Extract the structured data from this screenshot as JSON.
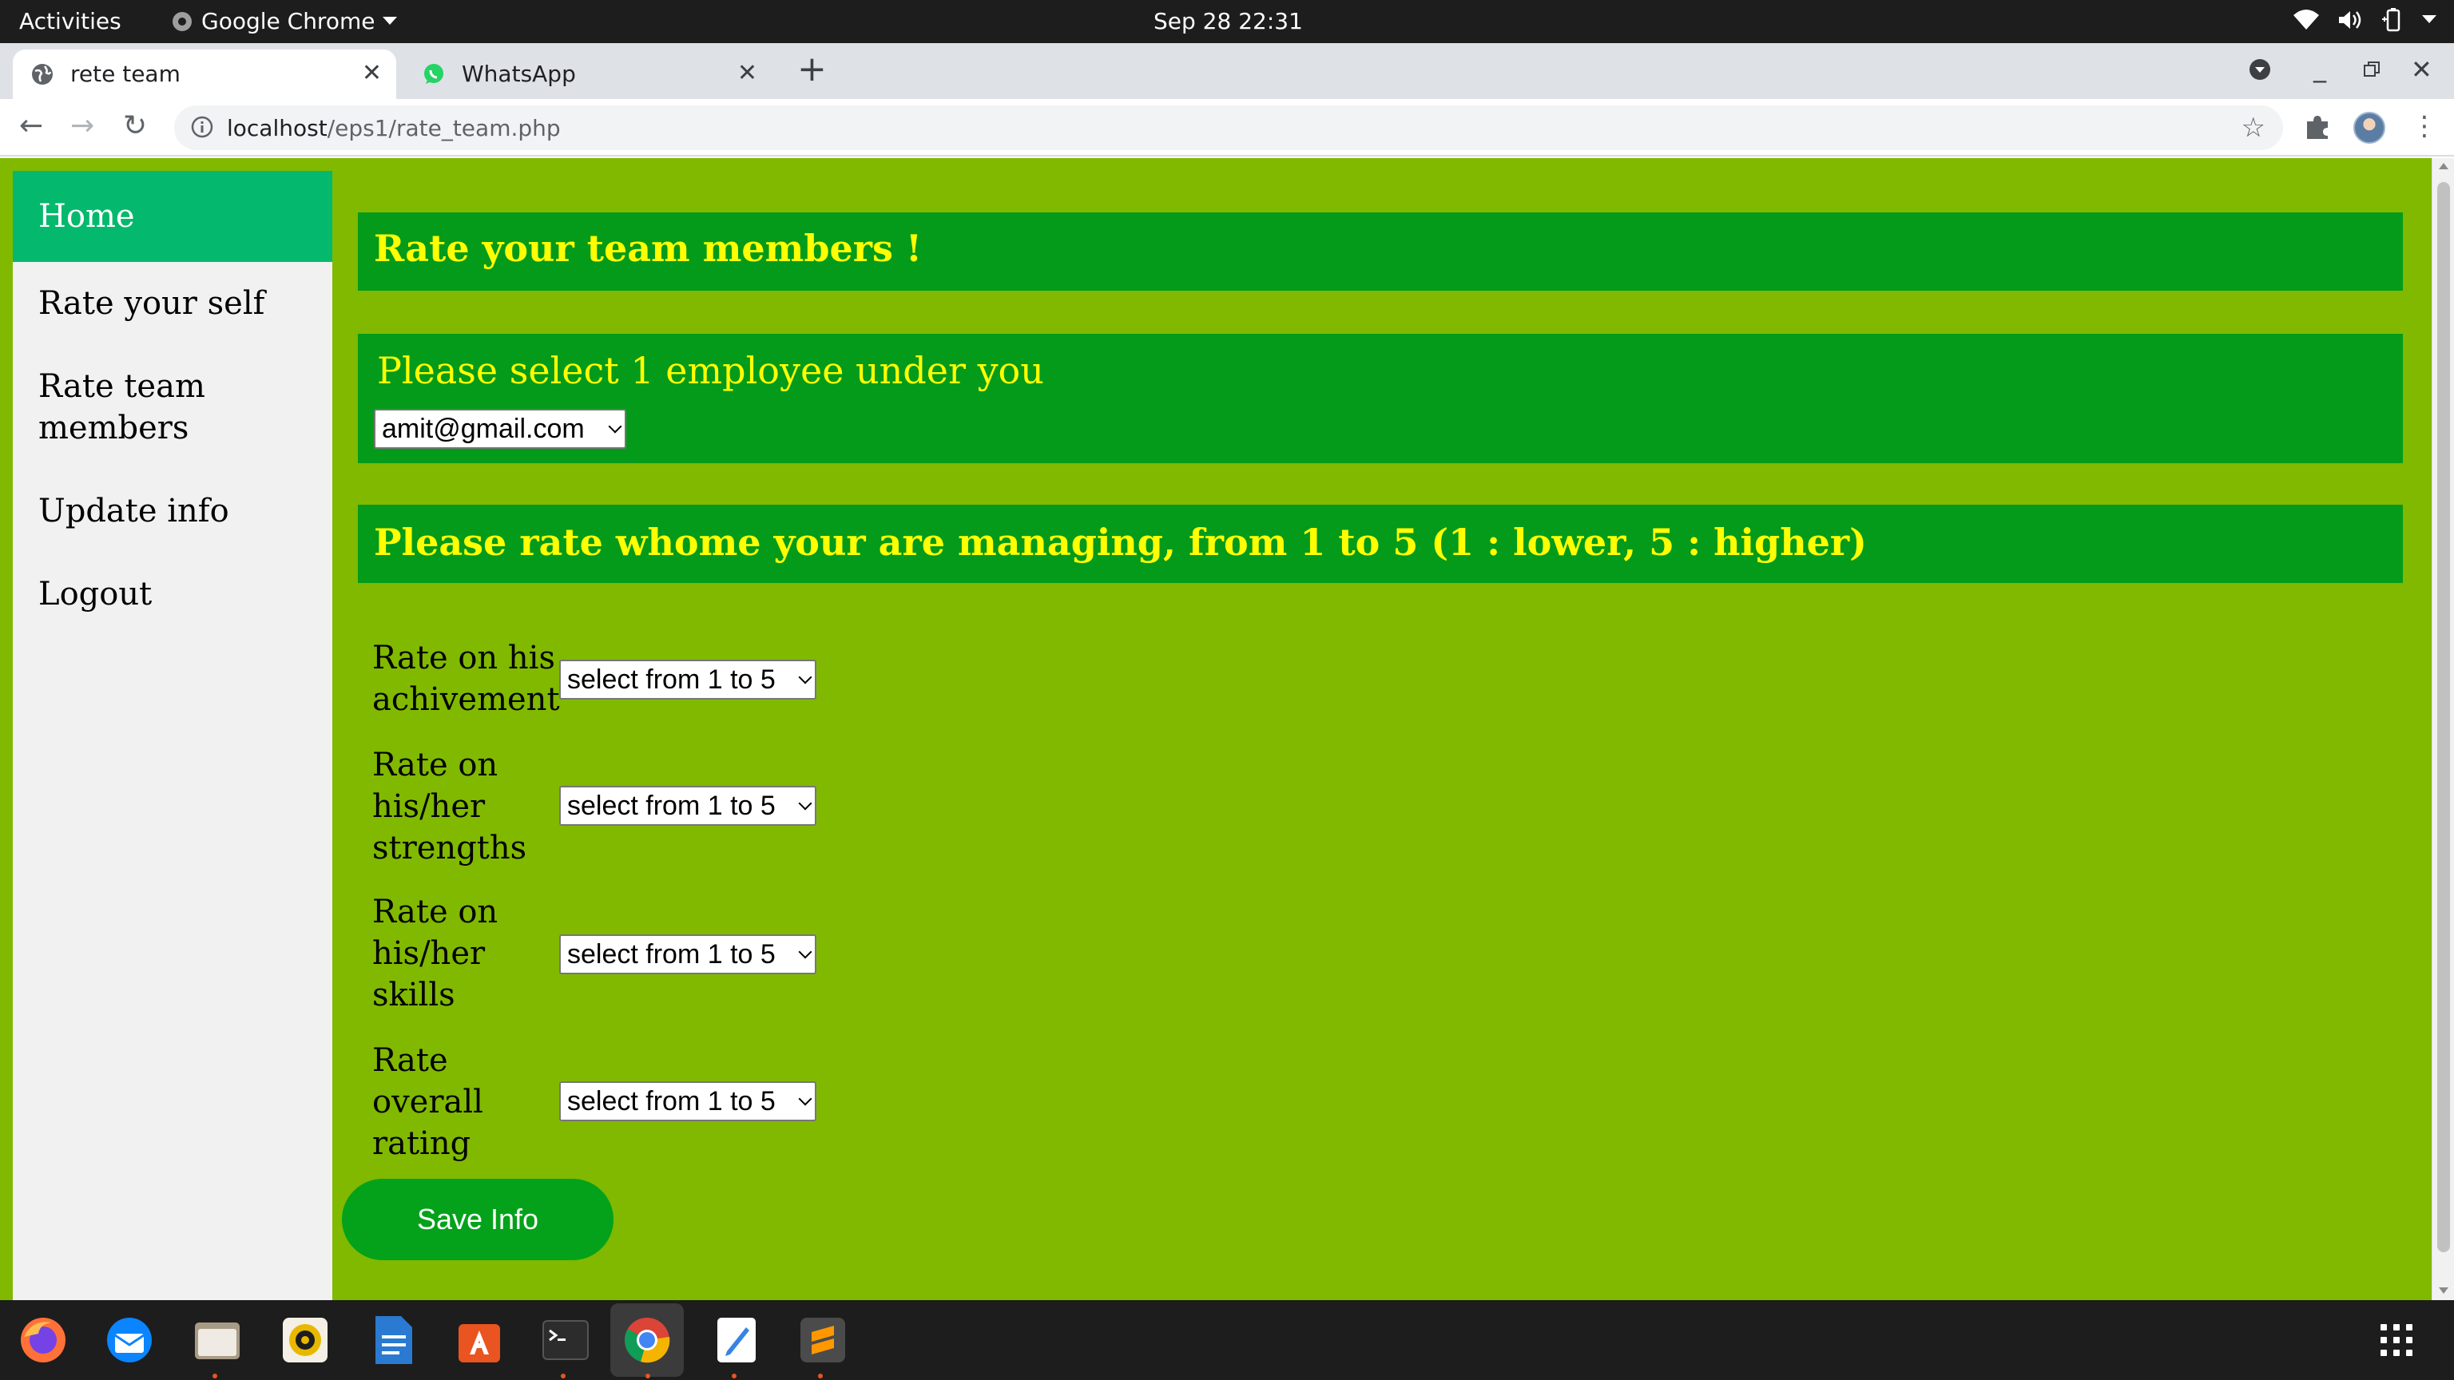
{
  "topbar": {
    "activities": "Activities",
    "app_name": "Google Chrome",
    "clock": "Sep 28  22:31"
  },
  "tabs": [
    {
      "title": "rete team",
      "icon": "globe-icon"
    },
    {
      "title": "WhatsApp",
      "icon": "whatsapp-icon"
    }
  ],
  "address": {
    "host": "localhost",
    "path": "/eps1/rate_team.php"
  },
  "sidebar": {
    "items": [
      {
        "label": "Home"
      },
      {
        "label": "Rate your self"
      },
      {
        "label": "Rate team members"
      },
      {
        "label": "Update info"
      },
      {
        "label": "Logout"
      }
    ]
  },
  "main": {
    "heading": "Rate your team members !",
    "employee_prompt": "Please select 1 employee under you",
    "employee_selected": "amit@gmail.com",
    "rate_instruction": "Please rate whome your are managing, from 1 to 5 (1 : lower, 5 : higher)",
    "ratings": [
      {
        "label": "Rate on his achivement",
        "selected": "select from 1 to 5"
      },
      {
        "label": "Rate on his/her strengths",
        "selected": "select from 1 to 5"
      },
      {
        "label": "Rate on his/her skills",
        "selected": "select from 1 to 5"
      },
      {
        "label": "Rate overall rating",
        "selected": "select from 1 to 5"
      }
    ],
    "save_label": "Save Info"
  },
  "dock": {
    "apps": [
      "firefox-icon",
      "thunderbird-icon",
      "files-icon",
      "rhythmbox-icon",
      "writer-icon",
      "software-icon",
      "terminal-icon",
      "chrome-icon",
      "text-editor-icon",
      "sublime-icon"
    ]
  },
  "colors": {
    "page_bg": "#80b900",
    "banner_bg": "#049b1a",
    "banner_text": "#ffff00",
    "nav_active": "#04b96d",
    "button_bg": "#04a21a"
  }
}
